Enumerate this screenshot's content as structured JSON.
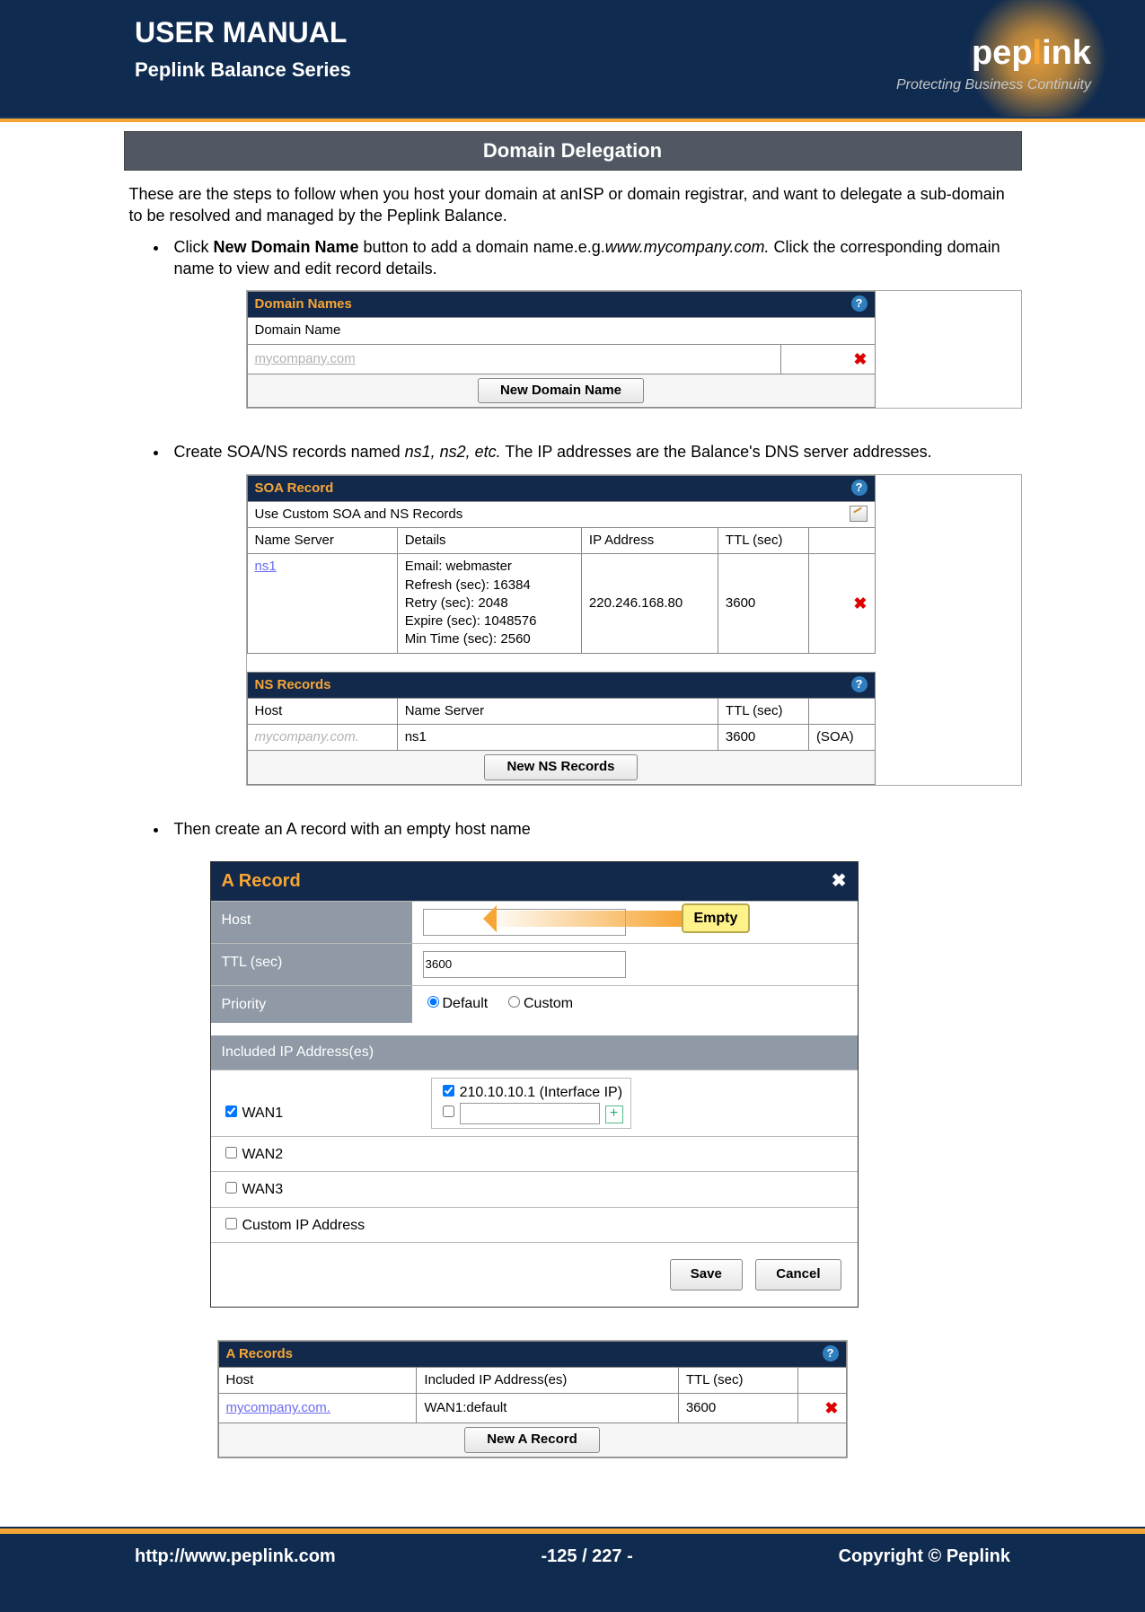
{
  "header": {
    "title": "USER MANUAL",
    "subtitle": "Peplink Balance Series",
    "brand_pre": "pep",
    "brand_mid": "l",
    "brand_post": "ink",
    "tagline": "Protecting Business Continuity"
  },
  "section_title": "Domain Delegation",
  "intro": "These are the steps to follow when you host your domain at anISP or domain registrar, and want to delegate a sub-domain to be resolved and managed by the Peplink Balance.",
  "step1_pre": "Click ",
  "step1_bold": "New Domain Name",
  "step1_mid": " button to add a domain name.e.g.",
  "step1_italic": "www.mycompany.com.",
  "step1_post": " Click the corresponding domain name to view and edit record details.",
  "fig1": {
    "title": "Domain Names",
    "col": "Domain Name",
    "row": "mycompany.com",
    "button": "New Domain Name",
    "delete_glyph": "✖",
    "help_glyph": "?"
  },
  "step2_pre": "Create SOA/NS records named ",
  "step2_italic": "ns1, ns2, etc.",
  "step2_post": " The IP addresses are the Balance's DNS server addresses.",
  "fig2": {
    "soa_title": "SOA Record",
    "soa_row": "Use Custom SOA and NS Records",
    "soa_cols": [
      "Name Server",
      "Details",
      "IP Address",
      "TTL (sec)"
    ],
    "soa_ns": "ns1",
    "soa_details": "Email: webmaster\nRefresh (sec): 16384\nRetry (sec): 2048\nExpire (sec): 1048576\nMin Time (sec): 2560",
    "soa_ip": "220.246.168.80",
    "soa_ttl": "3600",
    "ns_title": "NS Records",
    "ns_cols": [
      "Host",
      "Name Server",
      "TTL (sec)",
      ""
    ],
    "ns_host": "mycompany.com.",
    "ns_ns": "ns1",
    "ns_ttl": "3600",
    "ns_tag": "(SOA)",
    "ns_button": "New NS Records",
    "delete_glyph": "✖",
    "help_glyph": "?"
  },
  "step3": "Then create an A record with an empty host name",
  "fig3": {
    "title": "A Record",
    "close_glyph": "✖",
    "host_label": "Host",
    "empty_label": "Empty",
    "ttl_label": "TTL (sec)",
    "ttl_value": "3600",
    "priority_label": "Priority",
    "priority_default": "Default",
    "priority_custom": "Custom",
    "inc_label": "Included IP Address(es)",
    "wan1": "WAN1",
    "wan1_ip": "210.10.10.1 (Interface IP)",
    "wan2": "WAN2",
    "wan3": "WAN3",
    "custom_ip": "Custom IP Address",
    "save": "Save",
    "cancel": "Cancel",
    "plus_glyph": "+"
  },
  "fig4": {
    "title": "A Records",
    "cols": [
      "Host",
      "Included IP Address(es)",
      "TTL (sec)"
    ],
    "host": "mycompany.com.",
    "inc": "WAN1:default",
    "ttl": "3600",
    "button": "New A Record",
    "delete_glyph": "✖",
    "help_glyph": "?"
  },
  "footer": {
    "url": "http://www.peplink.com",
    "page": "-125 / 227 -",
    "copy": "Copyright ©  Peplink"
  }
}
